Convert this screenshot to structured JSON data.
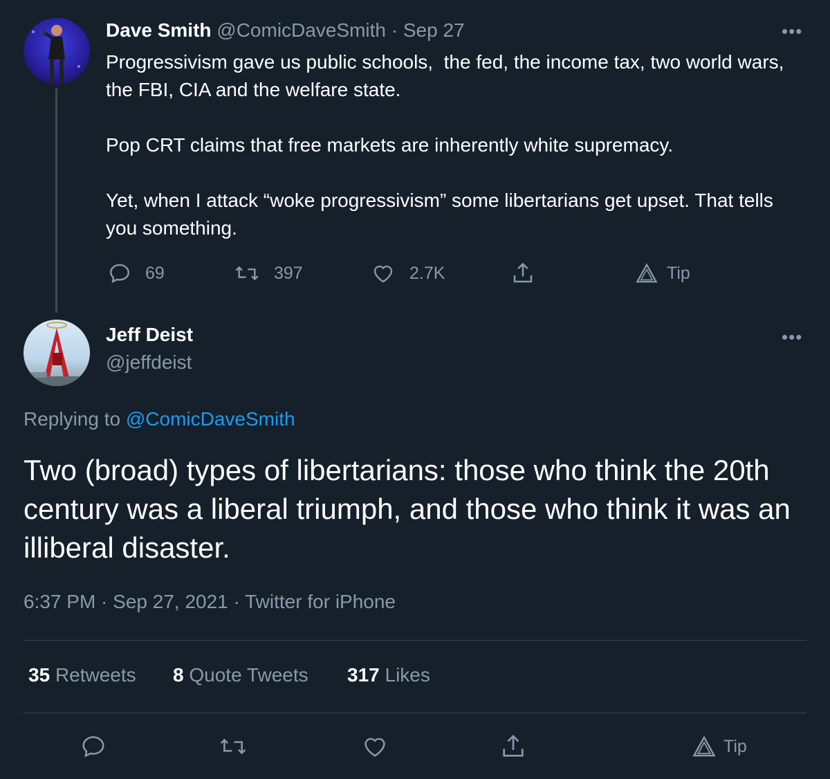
{
  "parent_tweet": {
    "author_name": "Dave Smith",
    "author_handle": "@ComicDaveSmith",
    "date": "· Sep 27",
    "more_label": "•••",
    "text": "Progressivism gave us public schools,  the fed, the income tax, two world wars, the FBI, CIA and the welfare state.\n\nPop CRT claims that free markets are inherently white supremacy.\n\nYet, when I attack “woke progressivism” some libertarians get upset. That tells you something.",
    "actions": {
      "replies": "69",
      "retweets": "397",
      "likes": "2.7K",
      "tip_label": "Tip"
    }
  },
  "main_tweet": {
    "author_name": "Jeff Deist",
    "author_handle": "@jeffdeist",
    "more_label": "•••",
    "replying_prefix": "Replying to ",
    "replying_handle": "@ComicDaveSmith",
    "text": "Two (broad) types of libertarians: those who think the 20th century was a liberal triumph, and those who think it was an illiberal disaster.",
    "timestamp": "6:37 PM · Sep 27, 2021 · Twitter for iPhone",
    "stats": {
      "retweets_count": "35",
      "retweets_label": "Retweets",
      "quotes_count": "8",
      "quotes_label": "Quote Tweets",
      "likes_count": "317",
      "likes_label": "Likes"
    },
    "tip_label": "Tip"
  },
  "colors": {
    "background": "#15202b",
    "text": "#ffffff",
    "muted": "#8b98a5",
    "link": "#1d9bf0",
    "divider": "#38444d"
  },
  "icons": [
    "reply-icon",
    "retweet-icon",
    "like-icon",
    "share-icon",
    "tip-icon",
    "more-icon"
  ]
}
